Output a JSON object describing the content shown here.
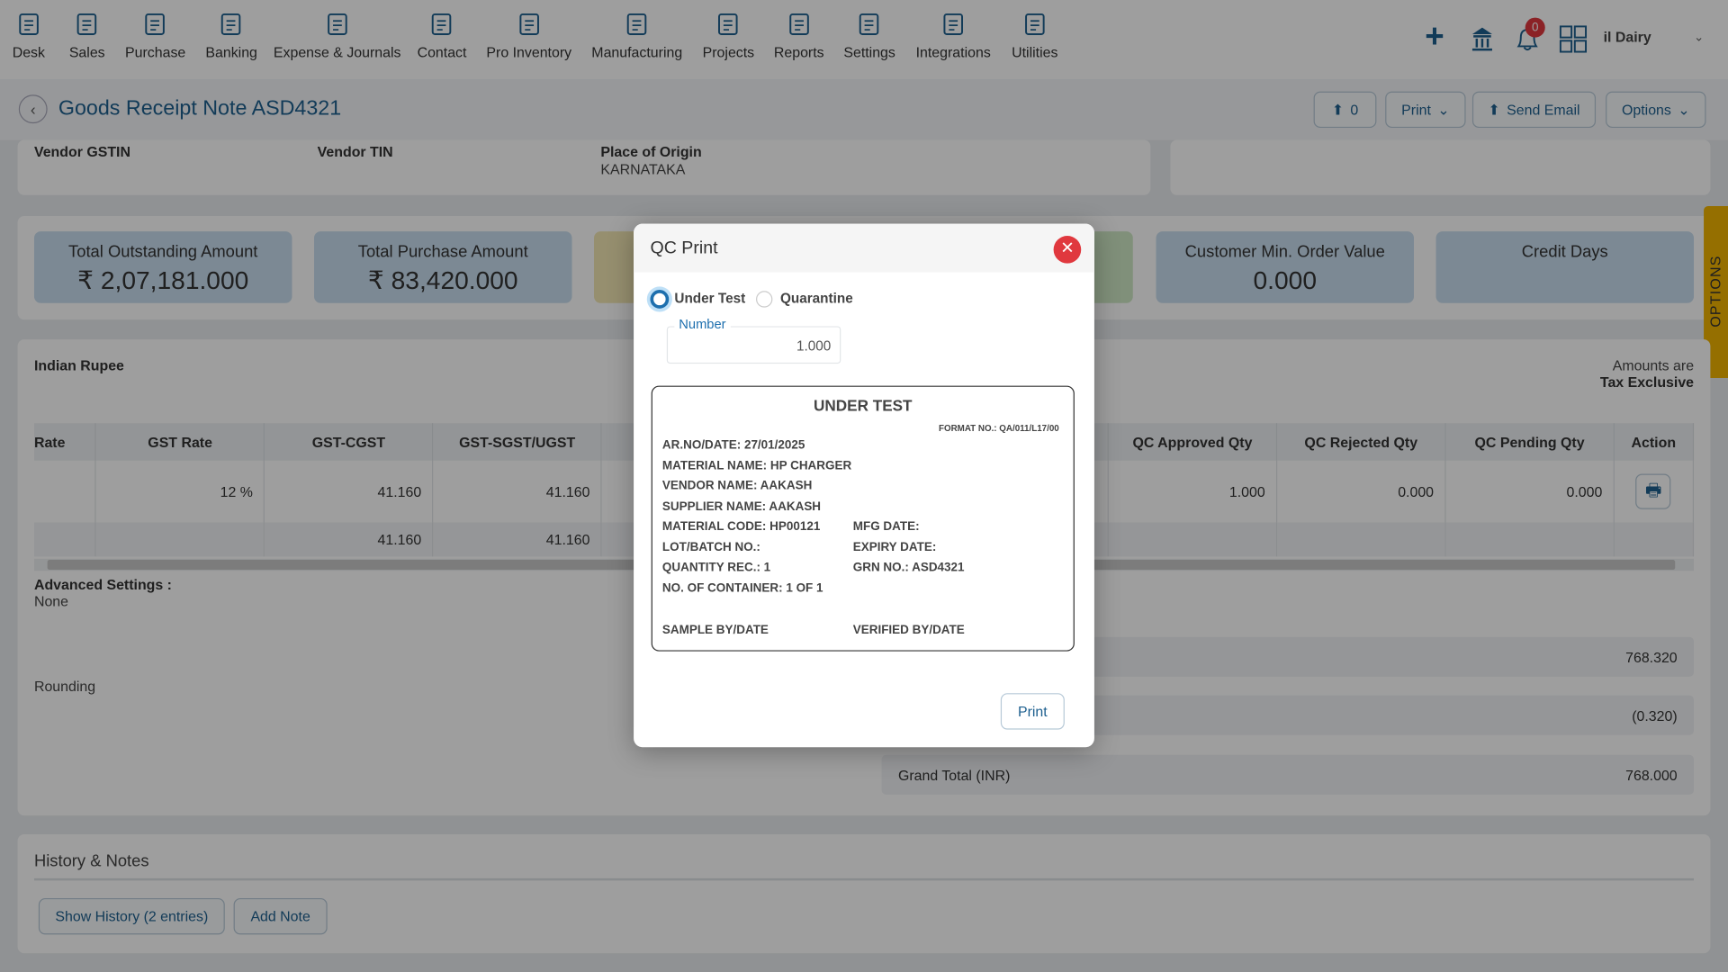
{
  "nav": {
    "items": [
      {
        "label": "Desk",
        "icon": "desk-icon"
      },
      {
        "label": "Sales",
        "icon": "sales-icon"
      },
      {
        "label": "Purchase",
        "icon": "cart-icon"
      },
      {
        "label": "Banking",
        "icon": "bank-icon"
      },
      {
        "label": "Expense & Journals",
        "icon": "journal-icon"
      },
      {
        "label": "Contact",
        "icon": "contact-icon"
      },
      {
        "label": "Pro Inventory",
        "icon": "inventory-icon"
      },
      {
        "label": "Manufacturing",
        "icon": "factory-icon"
      },
      {
        "label": "Projects",
        "icon": "clipboard-icon"
      },
      {
        "label": "Reports",
        "icon": "report-icon"
      },
      {
        "label": "Settings",
        "icon": "sliders-icon"
      },
      {
        "label": "Integrations",
        "icon": "plug-icon"
      },
      {
        "label": "Utilities",
        "icon": "utilities-icon"
      }
    ],
    "notification_count": "0",
    "company": "il Dairy"
  },
  "header": {
    "title": "Goods Receipt Note ASD4321",
    "upload_count": "0",
    "print": "Print",
    "send_email": "Send Email",
    "options": "Options"
  },
  "vendor": {
    "gstin_label": "Vendor GSTIN",
    "tin_label": "Vendor TIN",
    "origin_label": "Place of Origin",
    "origin_value": "KARNATAKA"
  },
  "tiles": [
    {
      "label": "Total Outstanding Amount",
      "value": "₹ 2,07,181.000"
    },
    {
      "label": "Total Purchase Amount",
      "value": "₹ 83,420.000"
    },
    {
      "label": "Customer Min. Order Value",
      "value": "0.000"
    },
    {
      "label": "Credit Days",
      "value": ""
    }
  ],
  "options_tab": "OPTIONS",
  "main": {
    "currency": "Indian Rupee",
    "amounts_are": "Amounts are",
    "tax_mode": "Tax Exclusive",
    "columns": [
      "Rate",
      "GST Rate",
      "GST-CGST",
      "GST-SGST/UGST",
      "QC Approved Qty",
      "QC Rejected Qty",
      "QC Pending Qty",
      "Action"
    ],
    "row": {
      "gst_rate": "12 %",
      "cgst": "41.160",
      "sgst": "41.160",
      "approved": "1.000",
      "rejected": "0.000",
      "pending": "0.000"
    },
    "total_row": {
      "cgst": "41.160",
      "sgst": "41.160"
    },
    "advanced_label": "Advanced Settings :",
    "advanced_value": "None",
    "rounding_label": "Rounding",
    "subtotal": "768.320",
    "rounding_value": "(0.320)",
    "grand_total_label": "Grand Total (INR)",
    "grand_total": "768.000"
  },
  "history": {
    "title": "History & Notes",
    "show_history": "Show History (2 entries)",
    "add_note": "Add Note"
  },
  "modal": {
    "title": "QC Print",
    "radio_under_test": "Under Test",
    "radio_quarantine": "Quarantine",
    "selected": "Under Test",
    "number_label": "Number",
    "number_value": "1.000",
    "print": "Print",
    "preview": {
      "heading": "UNDER TEST",
      "format_no": "FORMAT NO.: QA/011/L17/00",
      "ar_no": "AR.NO/DATE: 27/01/2025",
      "material_name": "MATERIAL NAME: HP CHARGER",
      "vendor_name": "VENDOR NAME: AAKASH",
      "supplier_name": "SUPPLIER NAME: AAKASH",
      "material_code": "MATERIAL CODE: HP00121",
      "mfg_date": "MFG DATE:",
      "lot": "LOT/BATCH NO.:",
      "expiry": "EXPIRY DATE:",
      "qty": "QUANTITY REC.: 1",
      "grn": "GRN NO.: ASD4321",
      "containers": "NO. OF CONTAINER: 1 OF 1",
      "sample_by": "SAMPLE BY/DATE",
      "verified_by": "VERIFIED BY/DATE"
    }
  },
  "colors": {
    "accent": "#1d5f8f",
    "close": "#e0383e",
    "options_tab": "#f0b400",
    "badge": "#e0383e"
  }
}
